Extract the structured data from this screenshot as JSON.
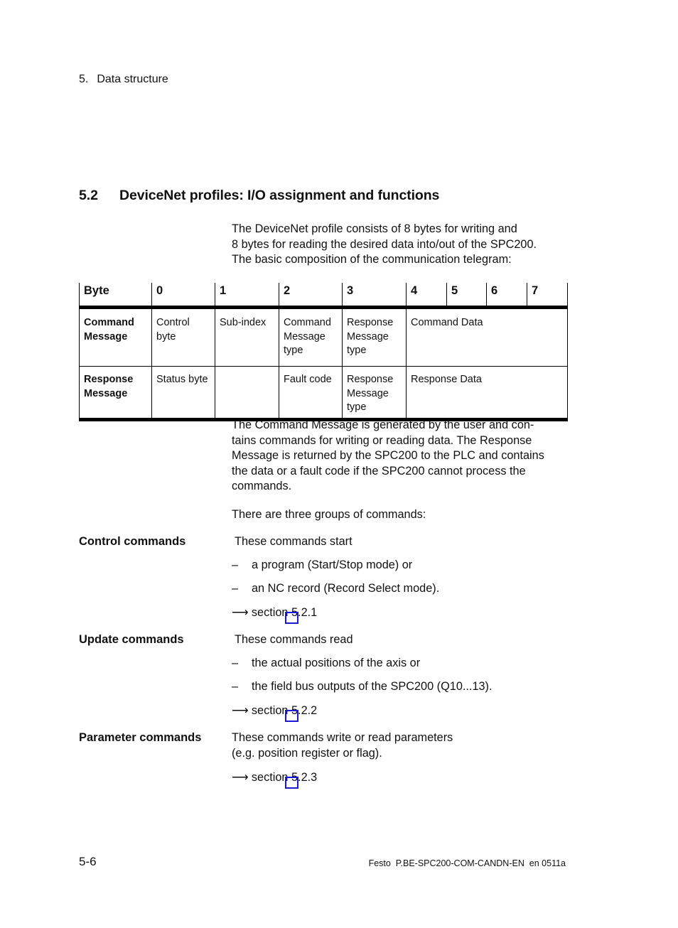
{
  "running_head": {
    "number": "5.",
    "title": "Data structure"
  },
  "section": {
    "number": "5.2",
    "title": "DeviceNet profiles: I/O assignment and functions"
  },
  "intro": {
    "lines": [
      "The DeviceNet profile consists of 8 bytes for writing and",
      "8 bytes for reading the desired data into/out of the SPC200.",
      "The basic composition of the communication telegram:"
    ]
  },
  "table": {
    "headers": [
      "Byte",
      "0",
      "1",
      "2",
      "3",
      "4",
      "5",
      "6",
      "7"
    ],
    "rows": [
      {
        "label": "Command Message",
        "cells": [
          "Control byte",
          "Sub-index",
          "Command Message type",
          "Response Message type",
          "Command Data"
        ]
      },
      {
        "label": "Response Message",
        "cells": [
          "Status byte",
          "",
          "Fault code",
          "Response Message type",
          "Response Data"
        ]
      }
    ]
  },
  "para2": {
    "lines": [
      "The Command Message is generated by the user and con-",
      "tains commands for writing or reading data. The Response",
      "Message is returned by the SPC200 to the PLC and contains",
      "the data or a fault code if the SPC200 cannot process the",
      "commands."
    ]
  },
  "para3": "There are three groups of commands:",
  "groups": [
    {
      "label": "Control commands",
      "intro": "These commands start",
      "bullets": [
        "a program (Start/Stop mode) or",
        "an NC record (Record Select mode)."
      ],
      "xref": "section 5.2.1"
    },
    {
      "label": "Update commands",
      "intro": "These commands read",
      "bullets": [
        "the actual positions of the axis or",
        "the field bus outputs of the SPC200 (Q10...13)."
      ],
      "xref": "section 5.2.2"
    },
    {
      "label": "Parameter commands",
      "intro_lines": [
        "These commands write or read parameters",
        "(e.g. position register or flag)."
      ],
      "xref": "section 5.2.3"
    }
  ],
  "symbols": {
    "dash": "–",
    "arrow": "⟶"
  },
  "colors": {
    "link_box": "#1a1ad6"
  },
  "footer": {
    "page": "5-6",
    "doc": "Festo  P.BE-SPC200-COM-CANDN-EN  en 0511a"
  }
}
